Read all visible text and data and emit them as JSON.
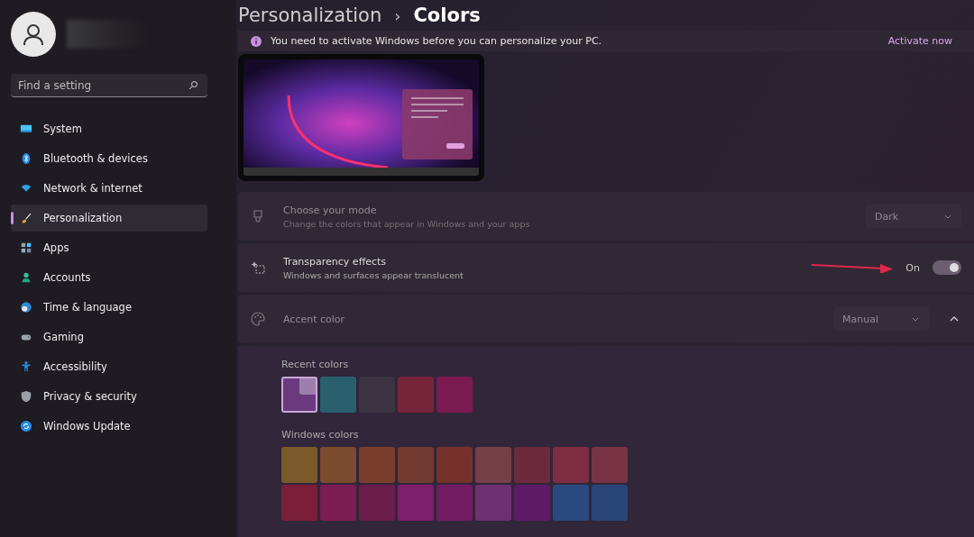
{
  "sidebar": {
    "search": {
      "placeholder": "Find a setting"
    },
    "items": [
      {
        "label": "System",
        "kind": "system",
        "selected": false
      },
      {
        "label": "Bluetooth & devices",
        "kind": "bluetooth",
        "selected": false
      },
      {
        "label": "Network & internet",
        "kind": "network",
        "selected": false
      },
      {
        "label": "Personalization",
        "kind": "brush",
        "selected": true
      },
      {
        "label": "Apps",
        "kind": "apps",
        "selected": false
      },
      {
        "label": "Accounts",
        "kind": "accounts",
        "selected": false
      },
      {
        "label": "Time & language",
        "kind": "time",
        "selected": false
      },
      {
        "label": "Gaming",
        "kind": "gaming",
        "selected": false
      },
      {
        "label": "Accessibility",
        "kind": "accessibility",
        "selected": false
      },
      {
        "label": "Privacy & security",
        "kind": "shield",
        "selected": false
      },
      {
        "label": "Windows Update",
        "kind": "update",
        "selected": false
      }
    ]
  },
  "breadcrumb": {
    "parent": "Personalization",
    "separator": "›",
    "current": "Colors"
  },
  "banner": {
    "text": "You need to activate Windows before you can personalize your PC.",
    "link": "Activate now"
  },
  "settings": [
    {
      "kind": "dropdown",
      "title": "Choose your mode",
      "subtitle": "Change the colors that appear in Windows and your apps",
      "value": "Dark",
      "disabled": true
    },
    {
      "kind": "toggle",
      "title": "Transparency effects",
      "subtitle": "Windows and surfaces appear translucent",
      "state_label": "On",
      "on": true,
      "disabled": false
    },
    {
      "kind": "expander",
      "title": "Accent color",
      "value": "Manual",
      "expanded": true,
      "disabled": true
    }
  ],
  "accent": {
    "recent_label": "Recent colors",
    "recent": [
      {
        "color": "#6a3a7e",
        "selected": true
      },
      {
        "color": "#2a5f6e",
        "selected": false
      },
      {
        "color": "#3c3442",
        "selected": false
      },
      {
        "color": "#77253a",
        "selected": false
      },
      {
        "color": "#7a1a50",
        "selected": false
      }
    ],
    "windows_label": "Windows colors",
    "windows": [
      {
        "color": "#7a5a2a",
        "selected": false
      },
      {
        "color": "#7c4a2c",
        "selected": false
      },
      {
        "color": "#7c3e2c",
        "selected": false
      },
      {
        "color": "#723a30",
        "selected": false
      },
      {
        "color": "#76302a",
        "selected": false
      },
      {
        "color": "#774048",
        "selected": false
      },
      {
        "color": "#6c2a3c",
        "selected": false
      },
      {
        "color": "#7e2e40",
        "selected": false
      },
      {
        "color": "#783444",
        "selected": false
      },
      {
        "color": "#7a1e3a",
        "selected": false
      },
      {
        "color": "#7d1d55",
        "selected": false
      },
      {
        "color": "#6b1d4c",
        "selected": false
      },
      {
        "color": "#7f1e6b",
        "selected": false
      },
      {
        "color": "#731c64",
        "selected": false
      },
      {
        "color": "#6e3070",
        "selected": false
      },
      {
        "color": "#5e1a66",
        "selected": false
      },
      {
        "color": "#2a4a7f",
        "selected": false
      },
      {
        "color": "#2a4578",
        "selected": false
      }
    ]
  }
}
